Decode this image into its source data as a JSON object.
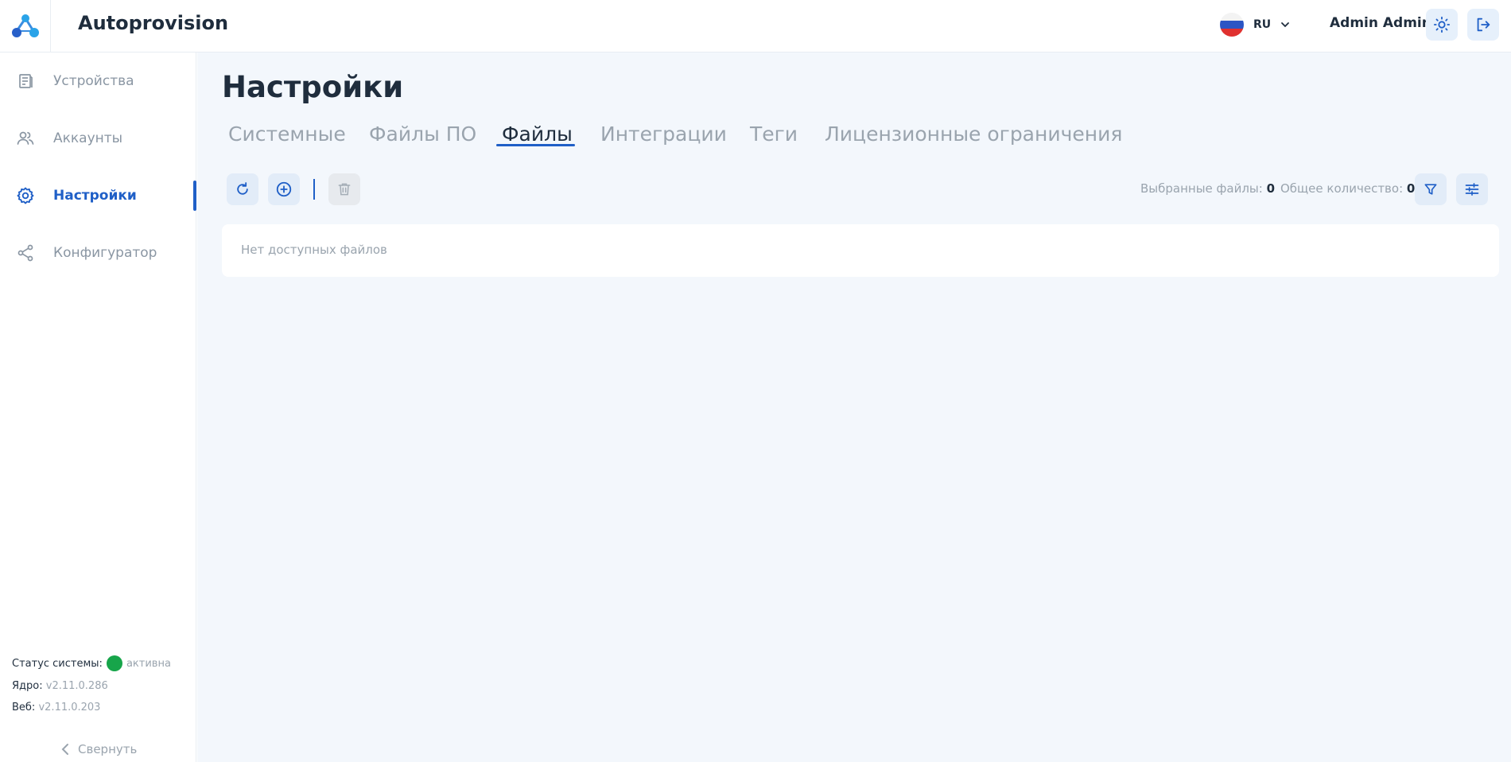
{
  "app": {
    "title": "Autoprovision"
  },
  "header": {
    "language": "RU",
    "user": "Admin Admin"
  },
  "sidebar": {
    "items": [
      {
        "label": "Устройства",
        "icon": "devices-icon"
      },
      {
        "label": "Аккаунты",
        "icon": "users-icon"
      },
      {
        "label": "Настройки",
        "icon": "gear-icon",
        "active": true
      },
      {
        "label": "Конфигуратор",
        "icon": "share-icon"
      }
    ],
    "status_label": "Статус системы:",
    "status_value": "активна",
    "core_label": "Ядро:",
    "core_version": "v2.11.0.286",
    "web_label": "Веб:",
    "web_version": "v2.11.0.203",
    "collapse_label": "Свернуть"
  },
  "main": {
    "title": "Настройки",
    "tabs": [
      {
        "label": "Системные"
      },
      {
        "label": "Файлы ПО"
      },
      {
        "label": "Файлы",
        "active": true
      },
      {
        "label": "Интеграции"
      },
      {
        "label": "Теги"
      },
      {
        "label": "Лицензионные ограничения"
      }
    ],
    "selected_label": "Выбранные файлы:",
    "selected_count": "0",
    "total_label": "Общее количество:",
    "total_count": "0",
    "empty_text": "Нет доступных файлов"
  },
  "colors": {
    "accent": "#1f5fc7",
    "background": "#f3f7fc",
    "status_active": "#17a54a"
  }
}
